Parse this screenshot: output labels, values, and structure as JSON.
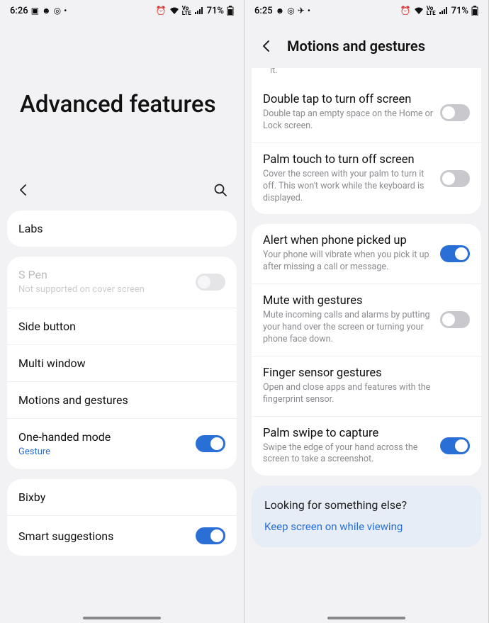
{
  "left": {
    "status": {
      "time": "6:26",
      "battery": "71%",
      "volte": "Vo\nLTE"
    },
    "title": "Advanced features",
    "groups": [
      [
        {
          "id": "labs",
          "title": "Labs",
          "sub": "",
          "toggle": null
        }
      ],
      [
        {
          "id": "spen",
          "title": "S Pen",
          "sub": "Not supported on cover screen",
          "toggle": "disabled",
          "disabled": true
        },
        {
          "id": "side-button",
          "title": "Side button",
          "sub": "",
          "toggle": null
        },
        {
          "id": "multi-window",
          "title": "Multi window",
          "sub": "",
          "toggle": null
        },
        {
          "id": "motions-gestures",
          "title": "Motions and gestures",
          "sub": "",
          "toggle": null
        },
        {
          "id": "one-handed",
          "title": "One-handed mode",
          "sub": "Gesture",
          "subLink": true,
          "toggle": "on"
        }
      ],
      [
        {
          "id": "bixby",
          "title": "Bixby",
          "sub": "",
          "toggle": null
        },
        {
          "id": "smart-suggestions",
          "title": "Smart suggestions",
          "sub": "",
          "toggle": "on"
        }
      ]
    ]
  },
  "right": {
    "status": {
      "time": "6:25",
      "battery": "71%",
      "volte": "Vo\nLTE"
    },
    "title": "Motions and gestures",
    "partial": "it.",
    "groups": [
      [
        {
          "id": "double-tap-off",
          "title": "Double tap to turn off screen",
          "sub": "Double tap an empty space on the Home or Lock screen.",
          "toggle": "off"
        },
        {
          "id": "palm-touch-off",
          "title": "Palm touch to turn off screen",
          "sub": "Cover the screen with your palm to turn it off. This won't work while the keyboard is displayed.",
          "toggle": "off"
        }
      ],
      [
        {
          "id": "alert-pickup",
          "title": "Alert when phone picked up",
          "sub": "Your phone will vibrate when you pick it up after missing a call or message.",
          "toggle": "on"
        },
        {
          "id": "mute-gestures",
          "title": "Mute with gestures",
          "sub": "Mute incoming calls and alarms by putting your hand over the screen or turning your phone face down.",
          "toggle": "off"
        },
        {
          "id": "finger-sensor",
          "title": "Finger sensor gestures",
          "sub": "Open and close apps and features with the fingerprint sensor.",
          "toggle": null
        },
        {
          "id": "palm-swipe",
          "title": "Palm swipe to capture",
          "sub": "Swipe the edge of your hand across the screen to take a screenshot.",
          "toggle": "on"
        }
      ]
    ],
    "suggestion": {
      "question": "Looking for something else?",
      "link": "Keep screen on while viewing"
    }
  }
}
